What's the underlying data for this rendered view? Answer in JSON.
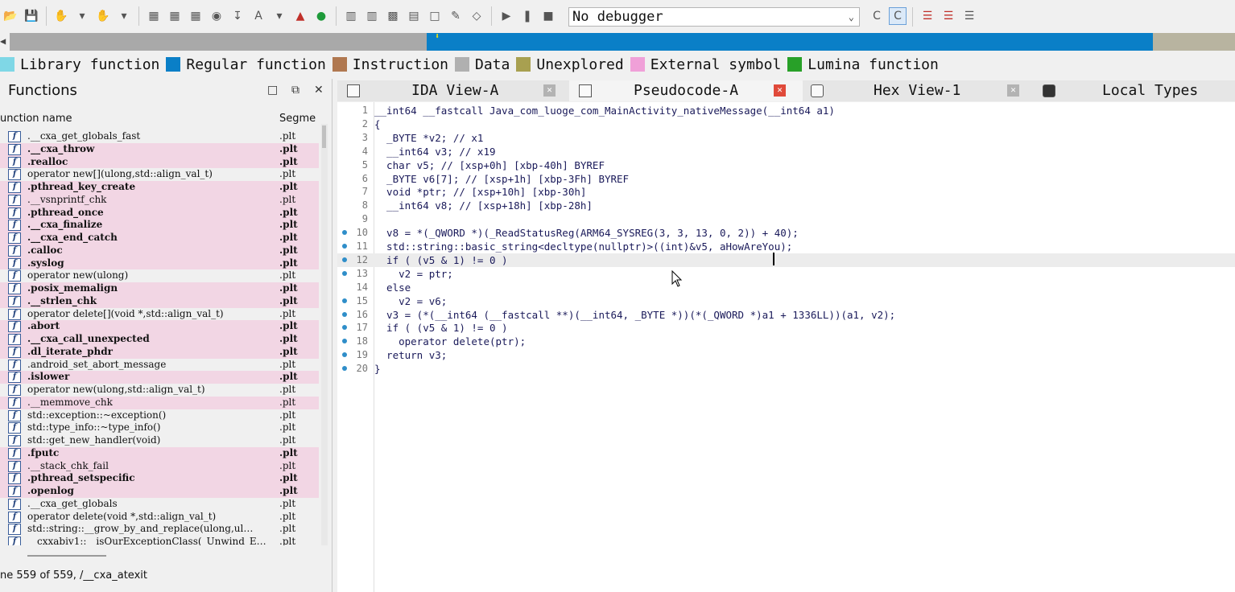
{
  "toolbar": {
    "debugger_label": "No debugger"
  },
  "legend": [
    {
      "label": "Library function",
      "color": "#7fd7e6"
    },
    {
      "label": "Regular function",
      "color": "#0a7fc7"
    },
    {
      "label": "Instruction",
      "color": "#b07850"
    },
    {
      "label": "Data",
      "color": "#b0b0b0"
    },
    {
      "label": "Unexplored",
      "color": "#a8a050"
    },
    {
      "label": "External symbol",
      "color": "#f0a0d8"
    },
    {
      "label": "Lumina function",
      "color": "#28a028"
    }
  ],
  "functions": {
    "title": "Functions",
    "col_name": "unction name",
    "col_segment": "Segme",
    "status": "ne 559 of 559, /__cxa_atexit",
    "rows": [
      {
        "name": ".__cxa_get_globals_fast",
        "seg": ".plt",
        "bold": false,
        "pink": false
      },
      {
        "name": ".__cxa_throw",
        "seg": ".plt",
        "bold": true,
        "pink": true
      },
      {
        "name": ".realloc",
        "seg": ".plt",
        "bold": true,
        "pink": true
      },
      {
        "name": "operator new[](ulong,std::align_val_t)",
        "seg": ".plt",
        "bold": false,
        "pink": false
      },
      {
        "name": ".pthread_key_create",
        "seg": ".plt",
        "bold": true,
        "pink": true
      },
      {
        "name": ".__vsnprintf_chk",
        "seg": ".plt",
        "bold": false,
        "pink": true
      },
      {
        "name": ".pthread_once",
        "seg": ".plt",
        "bold": true,
        "pink": true
      },
      {
        "name": ".__cxa_finalize",
        "seg": ".plt",
        "bold": true,
        "pink": true
      },
      {
        "name": ".__cxa_end_catch",
        "seg": ".plt",
        "bold": true,
        "pink": true
      },
      {
        "name": ".calloc",
        "seg": ".plt",
        "bold": true,
        "pink": true
      },
      {
        "name": ".syslog",
        "seg": ".plt",
        "bold": true,
        "pink": true
      },
      {
        "name": "operator new(ulong)",
        "seg": ".plt",
        "bold": false,
        "pink": false
      },
      {
        "name": ".posix_memalign",
        "seg": ".plt",
        "bold": true,
        "pink": true
      },
      {
        "name": ".__strlen_chk",
        "seg": ".plt",
        "bold": true,
        "pink": true
      },
      {
        "name": "operator delete[](void *,std::align_val_t)",
        "seg": ".plt",
        "bold": false,
        "pink": false
      },
      {
        "name": ".abort",
        "seg": ".plt",
        "bold": true,
        "pink": true
      },
      {
        "name": ".__cxa_call_unexpected",
        "seg": ".plt",
        "bold": true,
        "pink": true
      },
      {
        "name": ".dl_iterate_phdr",
        "seg": ".plt",
        "bold": true,
        "pink": true
      },
      {
        "name": ".android_set_abort_message",
        "seg": ".plt",
        "bold": false,
        "pink": false
      },
      {
        "name": ".islower",
        "seg": ".plt",
        "bold": true,
        "pink": true
      },
      {
        "name": "operator new(ulong,std::align_val_t)",
        "seg": ".plt",
        "bold": false,
        "pink": false
      },
      {
        "name": ".__memmove_chk",
        "seg": ".plt",
        "bold": false,
        "pink": true
      },
      {
        "name": "std::exception::~exception()",
        "seg": ".plt",
        "bold": false,
        "pink": false
      },
      {
        "name": "std::type_info::~type_info()",
        "seg": ".plt",
        "bold": false,
        "pink": false
      },
      {
        "name": "std::get_new_handler(void)",
        "seg": ".plt",
        "bold": false,
        "pink": false
      },
      {
        "name": ".fputc",
        "seg": ".plt",
        "bold": true,
        "pink": true
      },
      {
        "name": ".__stack_chk_fail",
        "seg": ".plt",
        "bold": false,
        "pink": true
      },
      {
        "name": ".pthread_setspecific",
        "seg": ".plt",
        "bold": true,
        "pink": true
      },
      {
        "name": ".openlog",
        "seg": ".plt",
        "bold": true,
        "pink": true
      },
      {
        "name": ".__cxa_get_globals",
        "seg": ".plt",
        "bold": false,
        "pink": false
      },
      {
        "name": "operator delete(void *,std::align_val_t)",
        "seg": ".plt",
        "bold": false,
        "pink": false
      },
      {
        "name": "std::string::__grow_by_and_replace(ulong,ul…",
        "seg": ".plt",
        "bold": false,
        "pink": false
      },
      {
        "name": "__cxxabiv1::__isOurExceptionClass(_Unwind_E…",
        "seg": ".plt",
        "bold": false,
        "pink": false
      }
    ]
  },
  "tabs": [
    {
      "label": "IDA View-A",
      "active": false
    },
    {
      "label": "Pseudocode-A",
      "active": true
    },
    {
      "label": "Hex View-1",
      "active": false
    },
    {
      "label": "Local Types",
      "active": false
    }
  ],
  "code_lines": [
    {
      "n": "1",
      "dot": false,
      "text": "__int64 __fastcall Java_com_luoge_com_MainActivity_nativeMessage(__int64 a1)"
    },
    {
      "n": "2",
      "dot": false,
      "text": "{"
    },
    {
      "n": "3",
      "dot": false,
      "text": "  _BYTE *v2; // x1"
    },
    {
      "n": "4",
      "dot": false,
      "text": "  __int64 v3; // x19"
    },
    {
      "n": "5",
      "dot": false,
      "text": "  char v5; // [xsp+0h] [xbp-40h] BYREF"
    },
    {
      "n": "6",
      "dot": false,
      "text": "  _BYTE v6[7]; // [xsp+1h] [xbp-3Fh] BYREF"
    },
    {
      "n": "7",
      "dot": false,
      "text": "  void *ptr; // [xsp+10h] [xbp-30h]"
    },
    {
      "n": "8",
      "dot": false,
      "text": "  __int64 v8; // [xsp+18h] [xbp-28h]"
    },
    {
      "n": "9",
      "dot": false,
      "text": ""
    },
    {
      "n": "10",
      "dot": true,
      "text": "  v8 = *(_QWORD *)(_ReadStatusReg(ARM64_SYSREG(3, 3, 13, 0, 2)) + 40);"
    },
    {
      "n": "11",
      "dot": true,
      "text": "  std::string::basic_string<decltype(nullptr)>((int)&v5, aHowAreYou);"
    },
    {
      "n": "12",
      "dot": true,
      "text": "  if ( (v5 & 1) != 0 )"
    },
    {
      "n": "13",
      "dot": true,
      "text": "    v2 = ptr;"
    },
    {
      "n": "14",
      "dot": false,
      "text": "  else"
    },
    {
      "n": "15",
      "dot": true,
      "text": "    v2 = v6;"
    },
    {
      "n": "16",
      "dot": true,
      "text": "  v3 = (*(__int64 (__fastcall **)(__int64, _BYTE *))(*(_QWORD *)a1 + 1336LL))(a1, v2);"
    },
    {
      "n": "17",
      "dot": true,
      "text": "  if ( (v5 & 1) != 0 )"
    },
    {
      "n": "18",
      "dot": true,
      "text": "    operator delete(ptr);"
    },
    {
      "n": "19",
      "dot": true,
      "text": "  return v3;"
    },
    {
      "n": "20",
      "dot": true,
      "text": "}"
    }
  ]
}
